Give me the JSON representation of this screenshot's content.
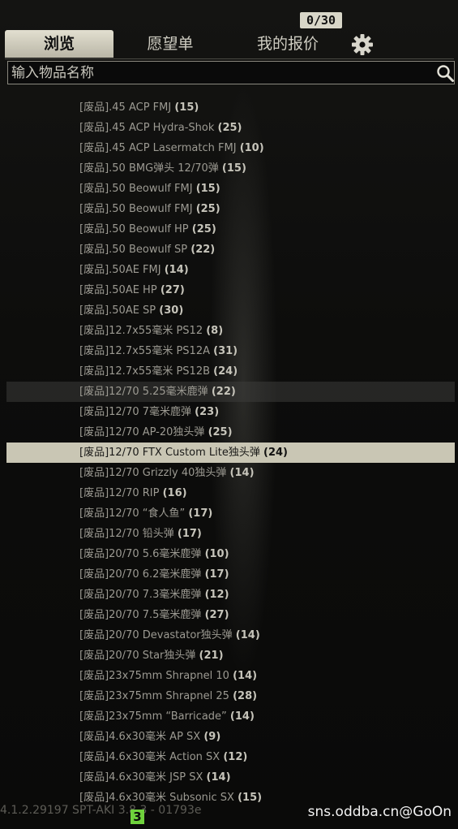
{
  "header": {
    "offer_counter": "0/30"
  },
  "tabs": [
    {
      "label": "浏览"
    },
    {
      "label": "愿望单"
    },
    {
      "label": "我的报价"
    }
  ],
  "icons": {
    "settings": "gear-icon",
    "search": "search-icon"
  },
  "search": {
    "placeholder": "输入物品名称",
    "value": ""
  },
  "items": [
    {
      "name": "[废品].45 ACP FMJ",
      "count": "(15)"
    },
    {
      "name": "[废品].45 ACP Hydra-Shok",
      "count": "(25)"
    },
    {
      "name": "[废品].45 ACP Lasermatch FMJ",
      "count": "(10)"
    },
    {
      "name": "[废品].50 BMG弹头 12/70弹",
      "count": "(15)"
    },
    {
      "name": "[废品].50 Beowulf FMJ",
      "count": "(15)"
    },
    {
      "name": "[废品].50 Beowulf FMJ",
      "count": "(25)"
    },
    {
      "name": "[废品].50 Beowulf HP",
      "count": "(25)"
    },
    {
      "name": "[废品].50 Beowulf SP",
      "count": "(22)"
    },
    {
      "name": "[废品].50AE FMJ",
      "count": "(14)"
    },
    {
      "name": "[废品].50AE HP",
      "count": "(27)"
    },
    {
      "name": "[废品].50AE SP",
      "count": "(30)"
    },
    {
      "name": "[废品]12.7x55毫米 PS12",
      "count": "(8)"
    },
    {
      "name": "[废品]12.7x55毫米 PS12A",
      "count": "(31)"
    },
    {
      "name": "[废品]12.7x55毫米 PS12B",
      "count": "(24)"
    },
    {
      "name": "[废品]12/70 5.25毫米鹿弹",
      "count": "(22)"
    },
    {
      "name": "[废品]12/70 7毫米鹿弹",
      "count": "(23)"
    },
    {
      "name": "[废品]12/70 AP-20独头弹",
      "count": "(25)"
    },
    {
      "name": "[废品]12/70 FTX Custom Lite独头弹",
      "count": "(24)"
    },
    {
      "name": "[废品]12/70 Grizzly 40独头弹",
      "count": "(14)"
    },
    {
      "name": "[废品]12/70 RIP",
      "count": "(16)"
    },
    {
      "name": "[废品]12/70 “食人鱼”",
      "count": "(17)"
    },
    {
      "name": "[废品]12/70 铅头弹",
      "count": "(17)"
    },
    {
      "name": "[废品]20/70 5.6毫米鹿弹",
      "count": "(10)"
    },
    {
      "name": "[废品]20/70 6.2毫米鹿弹",
      "count": "(17)"
    },
    {
      "name": "[废品]20/70 7.3毫米鹿弹",
      "count": "(12)"
    },
    {
      "name": "[废品]20/70 7.5毫米鹿弹",
      "count": "(27)"
    },
    {
      "name": "[废品]20/70 Devastator独头弹",
      "count": "(14)"
    },
    {
      "name": "[废品]20/70 Star独头弹",
      "count": "(21)"
    },
    {
      "name": "[废品]23x75mm Shrapnel 10",
      "count": "(14)"
    },
    {
      "name": "[废品]23x75mm Shrapnel 25",
      "count": "(28)"
    },
    {
      "name": "[废品]23x75mm “Barricade”",
      "count": "(14)"
    },
    {
      "name": "[废品]4.6x30毫米 AP SX",
      "count": "(9)"
    },
    {
      "name": "[废品]4.6x30毫米 Action SX",
      "count": "(12)"
    },
    {
      "name": "[废品]4.6x30毫米 JSP SX",
      "count": "(14)"
    },
    {
      "name": "[废品]4.6x30毫米 Subsonic SX",
      "count": "(15)"
    }
  ],
  "list_state": {
    "hover_index": 14,
    "selected_index": 17
  },
  "footer": {
    "version": "4.1.2.29197 SPT-AKI 3.8.3 - 01793e",
    "badge": "3",
    "watermark": "sns.oddba.cn@GoOn"
  },
  "colors": {
    "selected_row": "#c9c6b4",
    "active_tab": "#d8d5c5",
    "badge": "#6fd13c"
  }
}
